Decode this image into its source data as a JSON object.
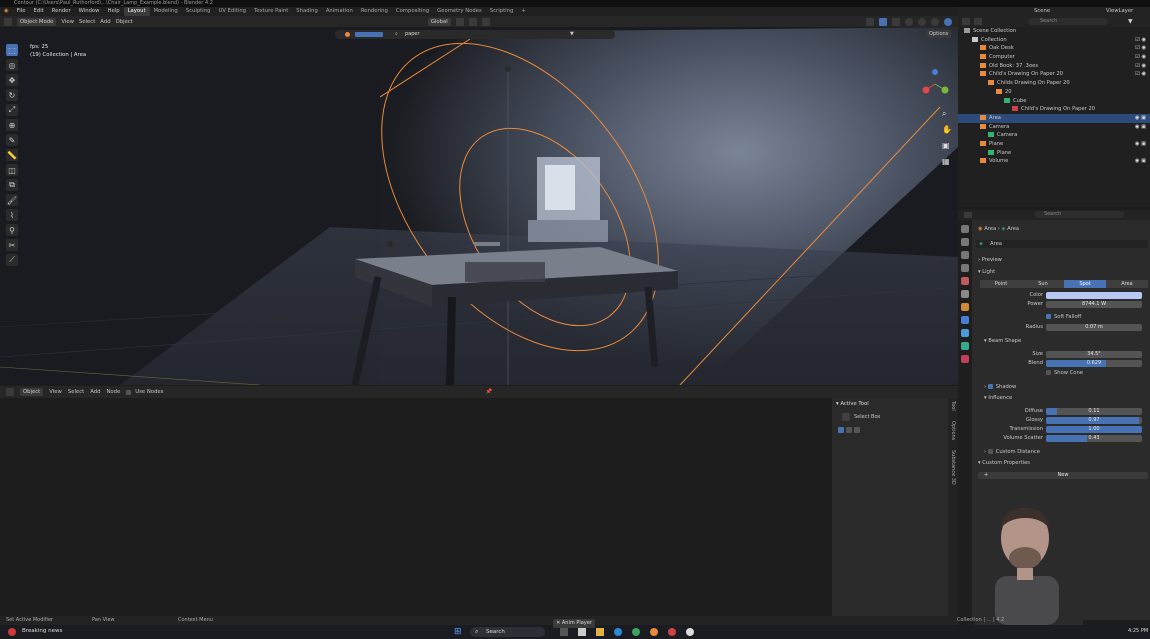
{
  "window": {
    "title": "Contour (C:\\Users\\Paul_Ruthorford\\...\\Chair_Lamp_Example.blend) - Blender 4.2"
  },
  "menu": {
    "items": [
      "File",
      "Edit",
      "Render",
      "Window",
      "Help"
    ],
    "workspaces": [
      "Layout",
      "Modeling",
      "Sculpting",
      "UV Editing",
      "Texture Paint",
      "Shading",
      "Animation",
      "Rendering",
      "Compositing",
      "Geometry Nodes",
      "Scripting"
    ],
    "active_workspace": "Layout",
    "add_workspace": "+",
    "scene_label": "Scene",
    "view_layer_label": "ViewLayer"
  },
  "viewport_header": {
    "mode": "Object Mode",
    "menus": [
      "View",
      "Select",
      "Add",
      "Object"
    ],
    "orientation": "Global",
    "search_value": "paper",
    "options_label": "Options"
  },
  "viewport": {
    "fps_text": "fps: 25",
    "collection_text": "(19) Collection | Area"
  },
  "node_editor_header": {
    "editor_type": "Object",
    "menus": [
      "View",
      "Select",
      "Add",
      "Node"
    ],
    "use_nodes_label": "Use Nodes"
  },
  "side_panel": {
    "section_title": "Active Tool",
    "tool_name": "Select Box",
    "tabs": [
      "Tool",
      "Options",
      "Substance 3D"
    ]
  },
  "status_bar": {
    "left": "Set Active Modifier",
    "middle": "Pan View",
    "right": "Context Menu",
    "far_right": "Collection | ... | 4.2",
    "anim_player": "Anim Player"
  },
  "outliner": {
    "search_placeholder": "Search",
    "rows": [
      {
        "label": "Scene Collection",
        "indent": 0,
        "icon_color": "#9a9a9a",
        "selected": false,
        "right": ""
      },
      {
        "label": "Collection",
        "indent": 1,
        "icon_color": "#c8c8c8",
        "selected": false,
        "right": "☑ ◉"
      },
      {
        "label": "Oak Desk",
        "indent": 2,
        "icon_color": "#e88a3b",
        "selected": false,
        "right": "☑ ◉"
      },
      {
        "label": "Computer",
        "indent": 2,
        "icon_color": "#e88a3b",
        "selected": false,
        "right": "☑ ◉"
      },
      {
        "label": "Old Book: 37 .3oes",
        "indent": 2,
        "icon_color": "#e88a3b",
        "selected": false,
        "right": "☑ ◉"
      },
      {
        "label": "Child's Drawing On Paper 20",
        "indent": 2,
        "icon_color": "#e88a3b",
        "selected": false,
        "right": "☑ ◉"
      },
      {
        "label": "Childs Drawing On Paper 20",
        "indent": 3,
        "icon_color": "#e88a3b",
        "selected": false,
        "right": ""
      },
      {
        "label": "20",
        "indent": 4,
        "icon_color": "#e88a3b",
        "selected": false,
        "right": ""
      },
      {
        "label": "Cube",
        "indent": 5,
        "icon_color": "#2fb56e",
        "selected": false,
        "right": ""
      },
      {
        "label": "Child's Drawing On Paper 20",
        "indent": 6,
        "icon_color": "#cc4444",
        "selected": false,
        "right": ""
      },
      {
        "label": "Area",
        "indent": 2,
        "icon_color": "#e88a3b",
        "selected": true,
        "right": "◉ ▣"
      },
      {
        "label": "Camera",
        "indent": 2,
        "icon_color": "#e88a3b",
        "selected": false,
        "right": "◉ ▣"
      },
      {
        "label": "Camera",
        "indent": 3,
        "icon_color": "#2fb56e",
        "selected": false,
        "right": ""
      },
      {
        "label": "Plane",
        "indent": 2,
        "icon_color": "#e88a3b",
        "selected": false,
        "right": "◉ ▣"
      },
      {
        "label": "Plane",
        "indent": 3,
        "icon_color": "#2fb56e",
        "selected": false,
        "right": ""
      },
      {
        "label": "Volume",
        "indent": 2,
        "icon_color": "#e88a3b",
        "selected": false,
        "right": "◉ ▣"
      }
    ]
  },
  "properties": {
    "breadcrumb": [
      "Area",
      "Area"
    ],
    "datablock_name": "Area",
    "sections": {
      "preview": "Preview",
      "light": "Light",
      "beam_shape": "Beam Shape",
      "shadow": "Shadow",
      "influence": "Influence",
      "custom_distance": "Custom Distance",
      "custom_properties": "Custom Properties"
    },
    "light_types": [
      "Point",
      "Sun",
      "Spot",
      "Area"
    ],
    "active_light_type": "Spot",
    "color_label": "Color",
    "color_value": "#b8c8f4",
    "power_label": "Power",
    "power_value": "8744.1 W",
    "soft_falloff_label": "Soft Falloff",
    "soft_falloff_checked": true,
    "radius_label": "Radius",
    "radius_value": "0.07 m",
    "size_label": "Size",
    "size_value": "34.5°",
    "blend_label": "Blend",
    "blend_value": "0.629",
    "blend_fraction": 0.629,
    "show_cone_label": "Show Cone",
    "show_cone_checked": false,
    "shadow_checked": true,
    "influence": [
      {
        "label": "Diffuse",
        "value": "0.11",
        "fraction": 0.11
      },
      {
        "label": "Glossy",
        "value": "0.97",
        "fraction": 0.97
      },
      {
        "label": "Transmission",
        "value": "1.00",
        "fraction": 1.0
      },
      {
        "label": "Volume Scatter",
        "value": "0.43",
        "fraction": 0.43
      }
    ],
    "new_button": "New",
    "search_placeholder": "Search"
  },
  "taskbar": {
    "news_title": "Breaking news",
    "search_label": "Search",
    "clock_time": "4:25 PM"
  },
  "colors": {
    "accent": "#4772b3",
    "selection_outline": "#e88a3b",
    "light_color": "#b8c8f4"
  }
}
